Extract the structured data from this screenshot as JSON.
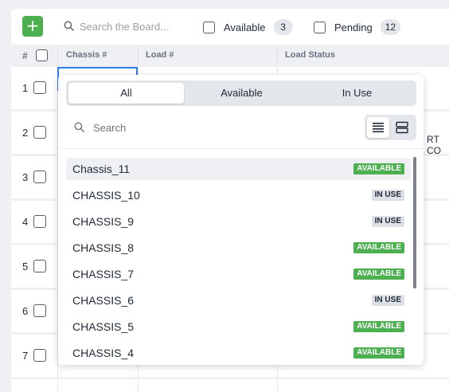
{
  "toolbar": {
    "add_label": "+",
    "search_placeholder": "Search the Board...",
    "filters": [
      {
        "label": "Available",
        "count": "3"
      },
      {
        "label": "Pending",
        "count": "12"
      }
    ]
  },
  "table": {
    "headers": {
      "num": "#",
      "chassis": "Chassis #",
      "load": "Load #",
      "status": "Load Status"
    },
    "rows": [
      "1",
      "2",
      "3",
      "4",
      "5",
      "6",
      "7"
    ],
    "partial_text": "RT CO"
  },
  "dropdown": {
    "tabs": [
      {
        "label": "All",
        "active": true
      },
      {
        "label": "Available",
        "active": false
      },
      {
        "label": "In Use",
        "active": false
      }
    ],
    "search_placeholder": "Search",
    "view_modes": [
      "list-view-icon",
      "card-view-icon"
    ],
    "options": [
      {
        "name": "Chassis_11",
        "status": "AVAILABLE",
        "highlighted": true
      },
      {
        "name": "CHASSIS_10",
        "status": "IN USE"
      },
      {
        "name": "CHASSIS_9",
        "status": "IN USE"
      },
      {
        "name": "CHASSIS_8",
        "status": "AVAILABLE"
      },
      {
        "name": "CHASSIS_7",
        "status": "AVAILABLE"
      },
      {
        "name": "CHASSIS_6",
        "status": "IN USE"
      },
      {
        "name": "CHASSIS_5",
        "status": "AVAILABLE"
      },
      {
        "name": "CHASSIS_4",
        "status": "AVAILABLE"
      }
    ]
  },
  "colors": {
    "accent_green": "#4caf50",
    "focus_blue": "#2e7cf6",
    "in_use_gray": "#dde1e6"
  }
}
